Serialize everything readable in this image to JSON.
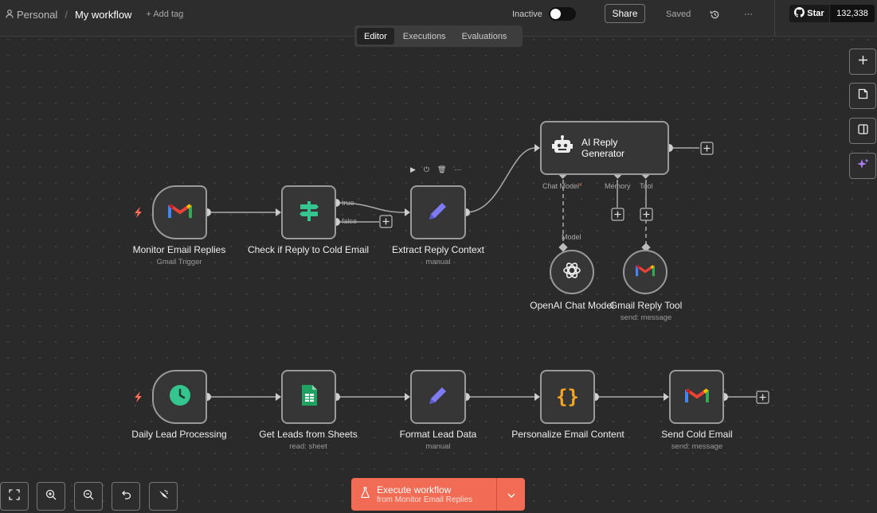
{
  "header": {
    "project": "Personal",
    "separator": "/",
    "workflow_name": "My workflow",
    "add_tag": "+ Add tag",
    "active_label": "Inactive",
    "share_label": "Share",
    "saved_label": "Saved",
    "more_label": "···",
    "github_star_label": "Star",
    "github_star_count": "132,338"
  },
  "tabs": [
    {
      "label": "Editor",
      "active": true
    },
    {
      "label": "Executions",
      "active": false
    },
    {
      "label": "Evaluations",
      "active": false
    }
  ],
  "nodes": {
    "monitor_email": {
      "title": "Monitor Email Replies",
      "subtitle": "Gmail Trigger",
      "icon": "gmail-icon"
    },
    "check_reply": {
      "title": "Check if Reply to Cold Email",
      "subtitle": "",
      "icon": "signpost-icon",
      "outputs": [
        "true",
        "false"
      ]
    },
    "extract_context": {
      "title": "Extract Reply Context",
      "subtitle": "manual",
      "icon": "pencil-icon"
    },
    "ai_reply": {
      "title": "AI Reply Generator",
      "icon": "robot-icon",
      "ports": [
        "Chat Model",
        "Memory",
        "Tool"
      ],
      "required_marker": "*"
    },
    "openai_model": {
      "title": "OpenAI Chat Model",
      "icon": "openai-icon",
      "port": "Model"
    },
    "gmail_tool": {
      "title": "Gmail Reply Tool",
      "subtitle": "send: message",
      "icon": "gmail-icon"
    },
    "daily_lead": {
      "title": "Daily Lead Processing",
      "icon": "clock-icon"
    },
    "get_leads": {
      "title": "Get Leads from Sheets",
      "subtitle": "read: sheet",
      "icon": "sheets-icon"
    },
    "format_lead": {
      "title": "Format Lead Data",
      "subtitle": "manual",
      "icon": "pencil-icon"
    },
    "personalize": {
      "title": "Personalize Email Content",
      "icon": "code-braces-icon"
    },
    "send_email": {
      "title": "Send Cold Email",
      "subtitle": "send: message",
      "icon": "gmail-icon"
    }
  },
  "execute": {
    "label": "Execute workflow",
    "sublabel": "from Monitor Email Replies"
  },
  "colors": {
    "accent": "#f26b54",
    "trigger": "#ff6d5a",
    "node_border": "#9a9a9a",
    "pencil": "#7e7bf3",
    "clock": "#35c58e",
    "braces": "#f5a623"
  }
}
